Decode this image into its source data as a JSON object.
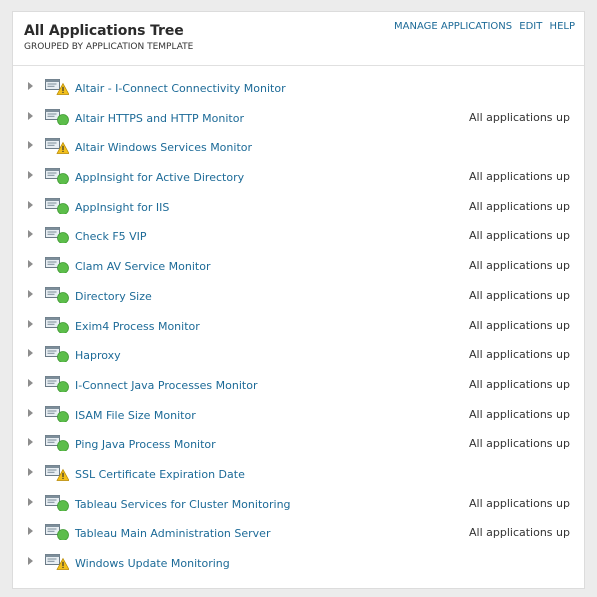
{
  "header": {
    "title": "All Applications Tree",
    "subtitle": "GROUPED BY APPLICATION TEMPLATE",
    "links": {
      "manage": "MANAGE APPLICATIONS",
      "edit": "EDIT",
      "help": "HELP"
    }
  },
  "colors": {
    "link": "#1c6a97",
    "ok": "#5cbd4a",
    "warning": "#f2c01c"
  },
  "items": [
    {
      "name": "Altair - I-Connect Connectivity Monitor",
      "status": "",
      "state": "warning"
    },
    {
      "name": "Altair HTTPS and HTTP Monitor",
      "status": "All applications up",
      "state": "up"
    },
    {
      "name": "Altair Windows Services Monitor",
      "status": "",
      "state": "warning"
    },
    {
      "name": "AppInsight for Active Directory",
      "status": "All applications up",
      "state": "up"
    },
    {
      "name": "AppInsight for IIS",
      "status": "All applications up",
      "state": "up"
    },
    {
      "name": "Check F5 VIP",
      "status": "All applications up",
      "state": "up"
    },
    {
      "name": "Clam AV Service Monitor",
      "status": "All applications up",
      "state": "up"
    },
    {
      "name": "Directory Size",
      "status": "All applications up",
      "state": "up"
    },
    {
      "name": "Exim4 Process Monitor",
      "status": "All applications up",
      "state": "up"
    },
    {
      "name": "Haproxy",
      "status": "All applications up",
      "state": "up"
    },
    {
      "name": "I-Connect Java Processes Monitor",
      "status": "All applications up",
      "state": "up"
    },
    {
      "name": "ISAM File Size Monitor",
      "status": "All applications up",
      "state": "up"
    },
    {
      "name": "Ping Java Process Monitor",
      "status": "All applications up",
      "state": "up"
    },
    {
      "name": "SSL Certificate Expiration Date",
      "status": "",
      "state": "warning"
    },
    {
      "name": "Tableau Services for Cluster Monitoring",
      "status": "All applications up",
      "state": "up"
    },
    {
      "name": "Tableau Main Administration Server",
      "status": "All applications up",
      "state": "up"
    },
    {
      "name": "Windows Update Monitoring",
      "status": "",
      "state": "warning"
    }
  ]
}
